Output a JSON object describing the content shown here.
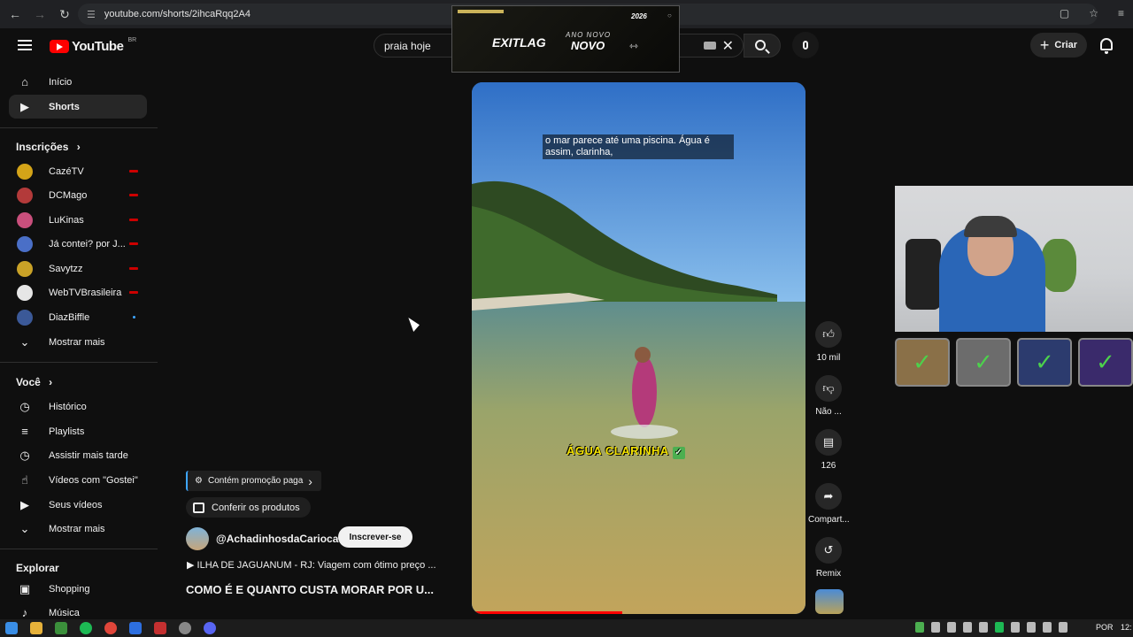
{
  "browser": {
    "url": "youtube.com/shorts/2ihcaRqq2A4"
  },
  "header": {
    "logo_text": "YouTube",
    "country_code": "BR",
    "search_value": "praia hoje",
    "create_label": "Criar"
  },
  "ad": {
    "brand": "EXITLAG",
    "subtitle": "ANO NOVO",
    "headline": "NOVO",
    "badge": "2026"
  },
  "sidebar": {
    "main": [
      {
        "label": "Início",
        "icon": "home-icon"
      },
      {
        "label": "Shorts",
        "icon": "shorts-icon",
        "active": true
      }
    ],
    "subscriptions_title": "Inscrições",
    "subscriptions": [
      {
        "label": "CazéTV",
        "status": "live",
        "color": "#d4a418"
      },
      {
        "label": "DCMago",
        "status": "live",
        "color": "#b33a3a"
      },
      {
        "label": "LuKinas",
        "status": "live",
        "color": "#c94f7c"
      },
      {
        "label": "Já contei? por J...",
        "status": "live",
        "color": "#4a6fc7"
      },
      {
        "label": "Savytzz",
        "status": "live",
        "color": "#c9a227"
      },
      {
        "label": "WebTVBrasileira",
        "status": "live",
        "color": "#e6e6e6"
      },
      {
        "label": "DiazBiffle",
        "status": "new",
        "color": "#3b5998"
      }
    ],
    "show_more_label": "Mostrar mais",
    "you_title": "Você",
    "you_items": [
      {
        "label": "Histórico",
        "icon": "history-icon"
      },
      {
        "label": "Playlists",
        "icon": "playlists-icon"
      },
      {
        "label": "Assistir mais tarde",
        "icon": "watch-later-icon"
      },
      {
        "label": "Vídeos com \"Gostei\"",
        "icon": "like-icon"
      },
      {
        "label": "Seus vídeos",
        "icon": "your-videos-icon"
      },
      {
        "label": "Mostrar mais",
        "icon": "chevron-down-icon"
      }
    ],
    "explore_title": "Explorar",
    "explore_items": [
      {
        "label": "Shopping",
        "icon": "shopping-icon"
      },
      {
        "label": "Música",
        "icon": "music-icon"
      }
    ]
  },
  "short": {
    "caption": "o mar parece até uma piscina. Água é assim, clarinha,",
    "overlay_text": "ÁGUA CLARINHA",
    "progress": 0.45,
    "promo_label": "Contém promoção paga",
    "products_label": "Conferir os produtos",
    "channel": "@AchadinhosdaCarioca",
    "subscribe_label": "Inscrever-se",
    "playlist": "ILHA DE JAGUANUM - RJ: Viagem com ótimo preço ...",
    "title": "COMO É E QUANTO CUSTA MORAR POR U..."
  },
  "actions": [
    {
      "label": "10 mil",
      "icon": "thumbs-up-icon"
    },
    {
      "label": "Não ...",
      "icon": "thumbs-down-icon"
    },
    {
      "label": "126",
      "icon": "comment-icon"
    },
    {
      "label": "Compart...",
      "icon": "share-icon"
    },
    {
      "label": "Remix",
      "icon": "remix-icon"
    }
  ],
  "taskbar": {
    "language": "POR",
    "time": "12:"
  }
}
